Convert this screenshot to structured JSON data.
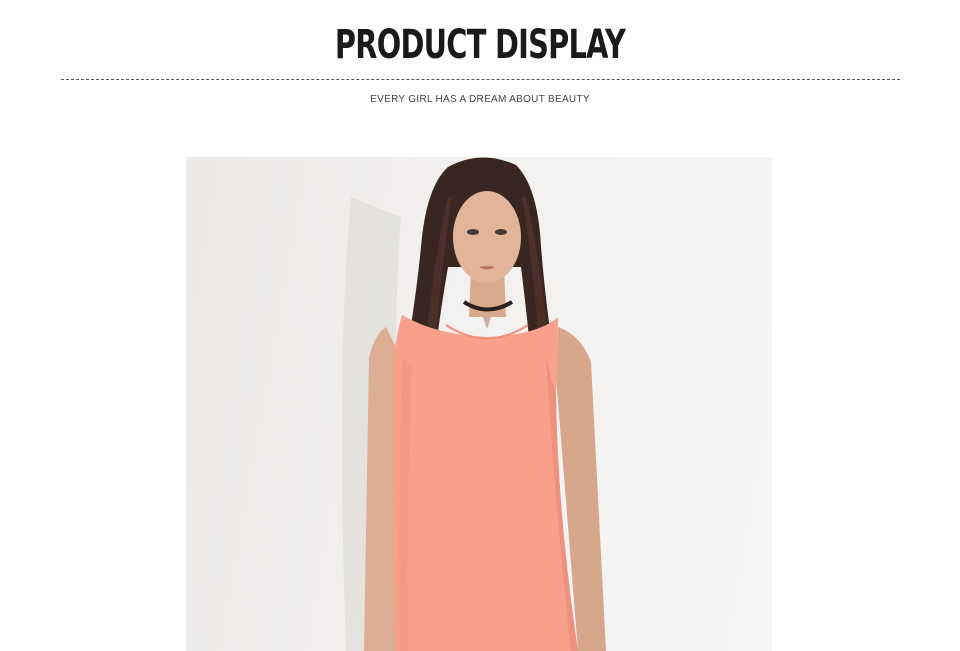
{
  "header": {
    "title": "PRODUCT DISPLAY",
    "subtitle": "EVERY GIRL HAS A DREAM ABOUT BEAUTY"
  },
  "product_image": {
    "subject": "model wearing coral sleeveless dress with black choker",
    "dress_color": "#f9a08c",
    "background_color": "#f1efee"
  }
}
